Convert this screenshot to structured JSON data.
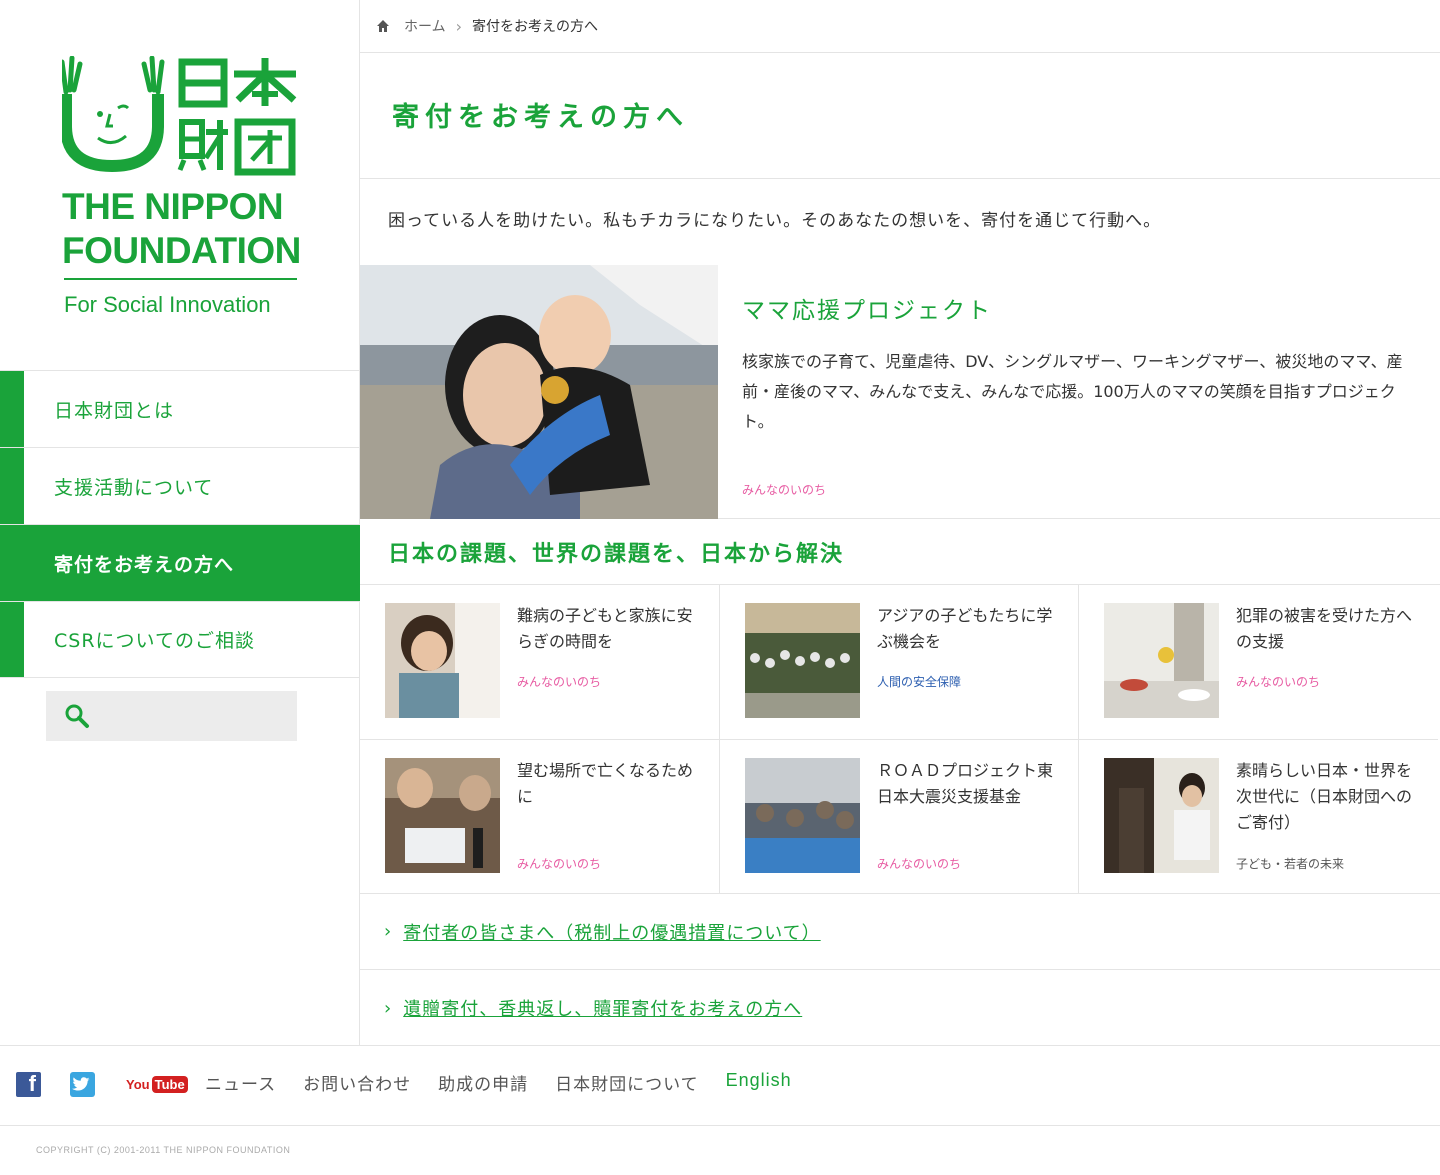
{
  "logo": {
    "en_line1": "THE NIPPON",
    "en_line2": "FOUNDATION",
    "tagline": "For Social Innovation"
  },
  "nav": {
    "items": [
      {
        "label": "日本財団とは"
      },
      {
        "label": "支援活動について"
      },
      {
        "label": "寄付をお考えの方へ"
      },
      {
        "label": "CSRについてのご相談"
      }
    ]
  },
  "search": {
    "placeholder": ""
  },
  "breadcrumb": {
    "home": "ホーム",
    "current": "寄付をお考えの方へ"
  },
  "page": {
    "title": "寄付をお考えの方へ",
    "lead": "困っている人を助けたい。私もチカラになりたい。そのあなたの想いを、寄付を通じて行動へ。"
  },
  "feature": {
    "title": "ママ応援プロジェクト",
    "description": "核家族での子育て、児童虐待、DV、シングルマザー、ワーキングマザー、被災地のママ、産前・産後のママ、みんなで支え、みんなで応援。100万人のママの笑顔を目指すプロジェクト。",
    "category": "みんなのいのち"
  },
  "section": {
    "title": "日本の課題、世界の課題を、日本から解決"
  },
  "cards": [
    {
      "title": "難病の子どもと家族に安らぎの時間を",
      "category": "みんなのいのち"
    },
    {
      "title": "アジアの子どもたちに学ぶ機会を",
      "category": "人間の安全保障"
    },
    {
      "title": "犯罪の被害を受けた方への支援",
      "category": "みんなのいのち"
    },
    {
      "title": "望む場所で亡くなるために",
      "category": "みんなのいのち"
    },
    {
      "title": "ＲＯＡＤプロジェクト東日本大震災支援基金",
      "category": "みんなのいのち"
    },
    {
      "title": "素晴らしい日本・世界を次世代に（日本財団へのご寄付）",
      "category": "子ども・若者の未来"
    }
  ],
  "links": [
    {
      "label": "寄付者の皆さまへ（税制上の優遇措置について）"
    },
    {
      "label": "遺贈寄付、香典返し、贖罪寄付をお考えの方へ"
    }
  ],
  "footer": {
    "facebook": "f",
    "youtube_you": "You",
    "youtube_tube": "Tube",
    "nav": [
      "ニュース",
      "お問い合わせ",
      "助成の申請",
      "日本財団について",
      "English"
    ],
    "copyright": "COPYRIGHT (C) 2001-2011 THE NIPPON FOUNDATION"
  },
  "colors": {
    "brand_green": "#1aa33a",
    "category_pink": "#e75ba2",
    "category_blue": "#2d5fb0"
  }
}
